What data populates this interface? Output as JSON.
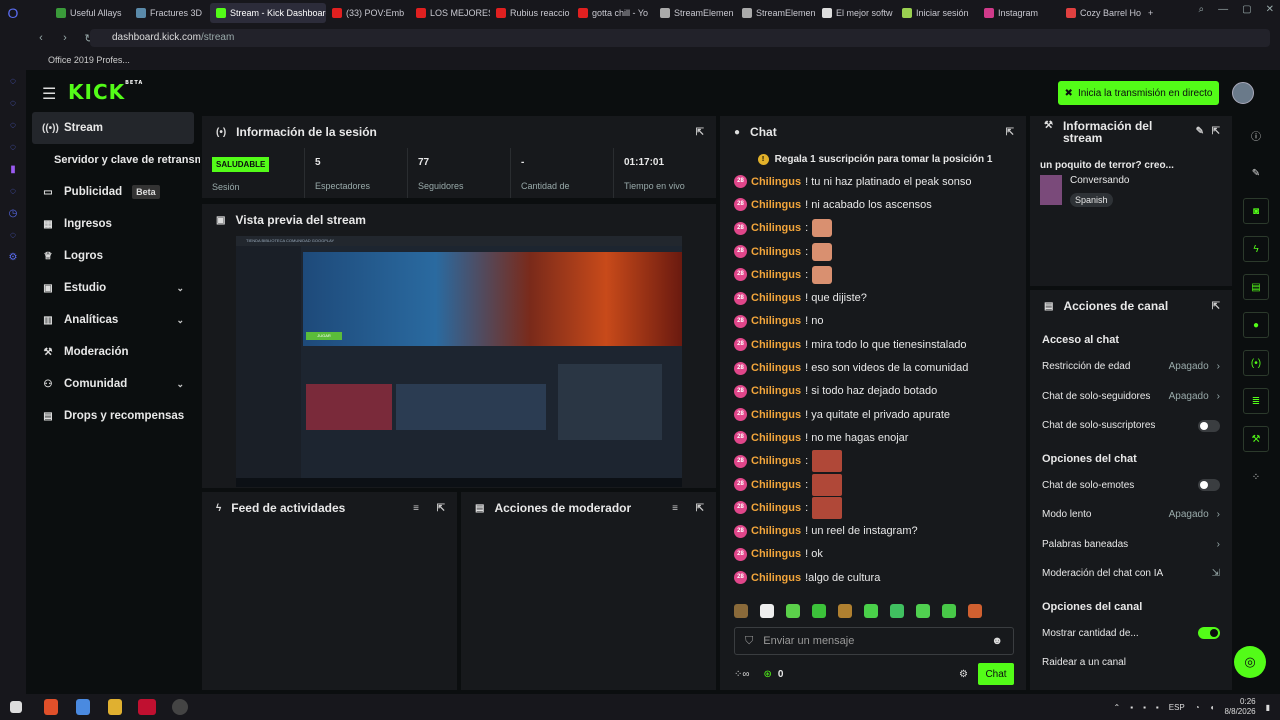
{
  "browser": {
    "tabs": [
      "Useful Allays",
      "Fractures 3D",
      "Stream - Kick Dashboard",
      "(33) POV:Emb",
      "LOS MEJORES",
      "Rubius reaccio",
      "gotta chill - Yo",
      "StreamElemen",
      "StreamElemen",
      "El mejor softw",
      "Iniciar sesión",
      "Instagram",
      "Cozy Barrel Ho"
    ],
    "url_host": "dashboard.kick.com",
    "url_path": "/stream",
    "bookmark": "Office 2019 Profes..."
  },
  "topbar": {
    "logo": "KICK",
    "beta": "BETA",
    "go_live": "Inicia la transmisión en directo"
  },
  "nav": {
    "stream": "Stream",
    "servidor": "Servidor y clave de retransmisión",
    "publicidad": "Publicidad",
    "beta": "Beta",
    "ingresos": "Ingresos",
    "logros": "Logros",
    "estudio": "Estudio",
    "analiticas": "Analíticas",
    "moderacion": "Moderación",
    "comunidad": "Comunidad",
    "drops": "Drops y recompensas"
  },
  "session": {
    "title": "Información de la sesión",
    "healthy": "SALUDABLE",
    "session_label": "Sesión",
    "viewers": "5",
    "viewers_label": "Espectadores",
    "followers": "77",
    "followers_label": "Seguidores",
    "amount": "-",
    "amount_label": "Cantidad de",
    "live_time": "01:17:01",
    "live_label": "Tiempo en vivo"
  },
  "preview": {
    "title": "Vista previa del stream",
    "game_tabs": "TIENDA  BIBLIOTECA  COMUNIDAD  GOOGPLAY",
    "button": "JUGAR"
  },
  "feed": {
    "title": "Feed de actividades"
  },
  "mod": {
    "title": "Acciones de moderador"
  },
  "chat": {
    "title": "Chat",
    "pinned": "Regala 1 suscripción para tomar la posición 1",
    "user": "Chilingus",
    "badge": "28",
    "messages": [
      {
        "text": "! tu ni haz platinado el peak sonso"
      },
      {
        "text": "! ni acabado los ascensos"
      },
      {
        "emote": "1"
      },
      {
        "emote": "1"
      },
      {
        "emote": "1"
      },
      {
        "text": "! que dijiste?"
      },
      {
        "text": "! no"
      },
      {
        "text": "! mira todo lo que tienesinstalado"
      },
      {
        "text": "! eso son videos de la comunidad"
      },
      {
        "text": "! si todo haz dejado botado"
      },
      {
        "text": "! ya quitate el privado apurate"
      },
      {
        "text": "! no me hagas enojar"
      },
      {
        "emote": "2"
      },
      {
        "emote": "2"
      },
      {
        "emote": "2"
      },
      {
        "text": "! un reel de instagram?"
      },
      {
        "text": "! ok"
      },
      {
        "text": "!algo de cultura"
      }
    ],
    "placeholder": "Enviar un mensaje",
    "count": "0",
    "send": "Chat"
  },
  "info": {
    "title": "Información del stream",
    "stream_title": "un poquito de terror? creo...",
    "category": "Conversando",
    "language": "Spanish"
  },
  "actions": {
    "title": "Acciones de canal",
    "chat_access": "Acceso al chat",
    "age": "Restricción de edad",
    "age_val": "Apagado",
    "followers_only": "Chat de solo-seguidores",
    "followers_val": "Apagado",
    "subs_only": "Chat de solo-suscriptores",
    "chat_opts": "Opciones del chat",
    "emotes_only": "Chat de solo-emotes",
    "slow": "Modo lento",
    "slow_val": "Apagado",
    "banned": "Palabras baneadas",
    "ai_mod": "Moderación del chat con IA",
    "channel_opts": "Opciones del canal",
    "show_count": "Mostrar cantidad de...",
    "raid": "Raidear a un canal"
  },
  "taskbar": {
    "lang": "ESP",
    "time": "0:26",
    "date": "8/8/2026"
  },
  "colors": {
    "accent": "#53fc18",
    "sub": "#e0468a",
    "name": "#f2a53b",
    "panel": "#17191c"
  }
}
